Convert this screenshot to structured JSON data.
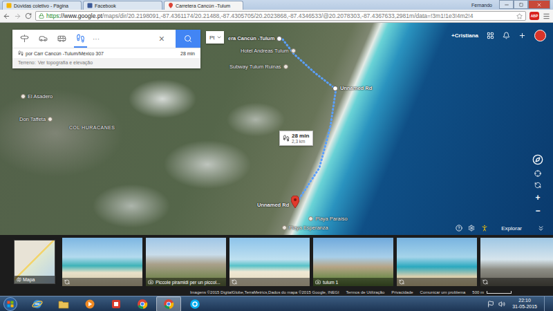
{
  "browser": {
    "tabs": [
      {
        "label": "Dúvidas coletivo - Página",
        "kind": "docs",
        "selected": false
      },
      {
        "label": "Facebook",
        "kind": "facebook",
        "selected": false
      },
      {
        "label": "Carretera Cancún -Tulum",
        "kind": "maps",
        "selected": true
      }
    ],
    "user": "Fernando",
    "url": {
      "scheme": "https",
      "host": "://www.google.pt",
      "path": "/maps/dir/20.2198091,-87.4361174/20.21488,-87.4305705/20.2023868,-87.4346533/@20.2078303,-87.4367633,2981m/data=!3m1!1e3!4m2!4"
    },
    "extension": "ABP"
  },
  "directions": {
    "modes": [
      {
        "kind": "directions",
        "selected": false
      },
      {
        "kind": "car",
        "selected": false
      },
      {
        "kind": "transit",
        "selected": false
      },
      {
        "kind": "walk",
        "selected": true
      }
    ],
    "more": "···",
    "close": "×",
    "route": "por Carr Cancún -Tulum/México 307",
    "duration": "28 min",
    "terrain": {
      "label": "Terreno:",
      "link": "Ver topografia e elevação"
    }
  },
  "language": "Pt",
  "account": {
    "name": "+Cristiana"
  },
  "map": {
    "places": [
      {
        "name": "era Cancún -Tulum",
        "kind": "waypoint"
      },
      {
        "name": "Hotel Andreas Tulum",
        "kind": "poi"
      },
      {
        "name": "Subway Tulum Ruinas",
        "kind": "poi"
      },
      {
        "name": "Unnamed Rd",
        "kind": "waypoint"
      },
      {
        "name": "El Asadero",
        "kind": "poi"
      },
      {
        "name": "Don Taffeta",
        "kind": "poi"
      },
      {
        "name": "COL HURACANES",
        "kind": "area"
      },
      {
        "name": "Unnamed Rd",
        "kind": "destination"
      },
      {
        "name": "Playa Paraíso",
        "kind": "poi"
      },
      {
        "name": "Playa Esperanza",
        "kind": "poi"
      }
    ],
    "route_info": {
      "duration": "28 min",
      "distance": "2,3 km"
    },
    "zoom_in": "+",
    "zoom_out": "−",
    "explore": "Explorar"
  },
  "photos": {
    "map_label": "Mapa",
    "items": [
      {
        "kind": "panorama"
      },
      {
        "kind": "photo",
        "caption": "Piccole piramidi per un piccol..."
      },
      {
        "kind": "panorama"
      },
      {
        "kind": "photo",
        "caption": "tulum 1"
      },
      {
        "kind": "panorama"
      },
      {
        "kind": "panorama"
      }
    ]
  },
  "footer": {
    "attribution": "Imagens ©2015 DigitalGlobe,TerraMetrics,Dados do mapa ©2015 Google, INEGI",
    "links": [
      "Termos de Utilização",
      "Privacidade",
      "Comunicar um problema"
    ],
    "scale": "500 m"
  },
  "taskbar": {
    "apps": [
      {
        "kind": "ie",
        "active": false
      },
      {
        "kind": "folder",
        "active": false
      },
      {
        "kind": "media",
        "active": false
      },
      {
        "kind": "app",
        "active": false
      },
      {
        "kind": "chrome",
        "active": false
      },
      {
        "kind": "chrome",
        "active": true
      },
      {
        "kind": "skype",
        "active": false
      }
    ],
    "time": "22:10",
    "date": "31-05-2015"
  }
}
